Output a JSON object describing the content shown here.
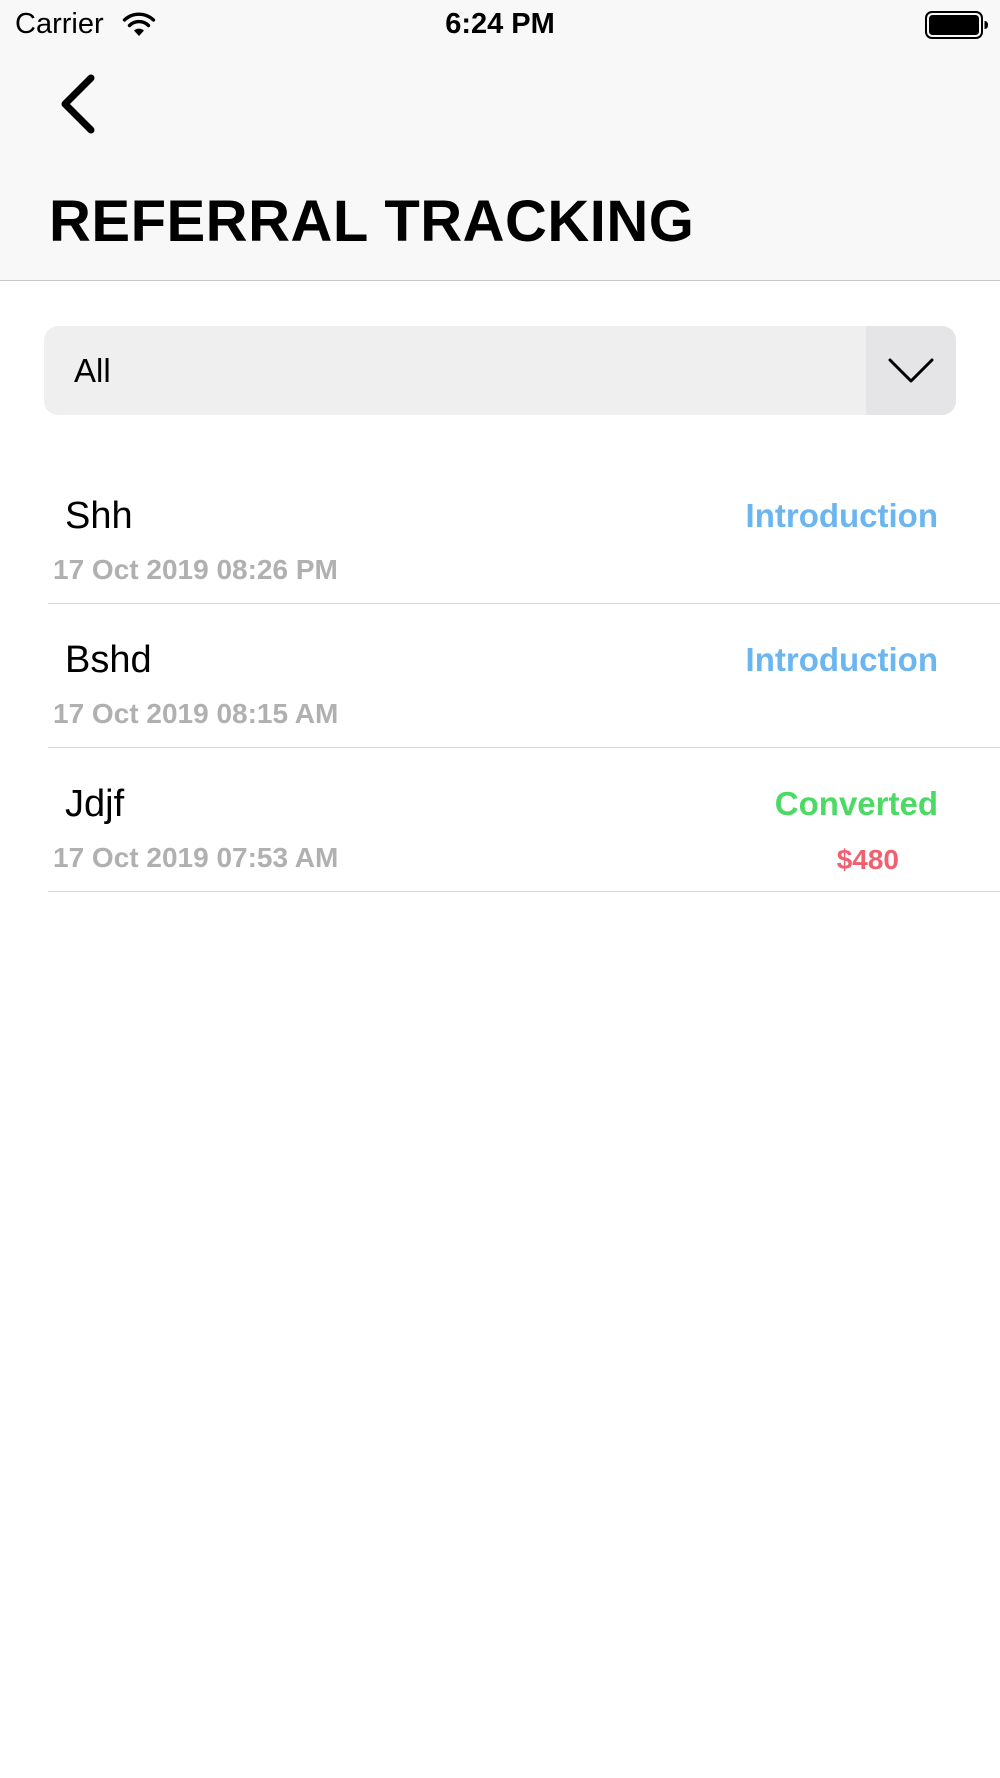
{
  "status_bar": {
    "carrier": "Carrier",
    "time": "6:24 PM",
    "wifi_icon": "wifi-icon",
    "battery_icon": "battery-icon"
  },
  "header": {
    "back_icon": "chevron-left-icon",
    "title": "REFERRAL TRACKING"
  },
  "filter": {
    "selected": "All",
    "arrow_icon": "chevron-down-icon"
  },
  "colors": {
    "introduction": "#6bb6f0",
    "converted": "#4cd964",
    "amount": "#f06070",
    "date": "#b0b0b0"
  },
  "referrals": [
    {
      "name": "Shh",
      "date": "17 Oct 2019 08:26 PM",
      "status": "Introduction",
      "amount": ""
    },
    {
      "name": "Bshd",
      "date": "17 Oct 2019 08:15 AM",
      "status": "Introduction",
      "amount": ""
    },
    {
      "name": "Jdjf",
      "date": "17 Oct 2019 07:53 AM",
      "status": "Converted",
      "amount": "$480"
    }
  ]
}
